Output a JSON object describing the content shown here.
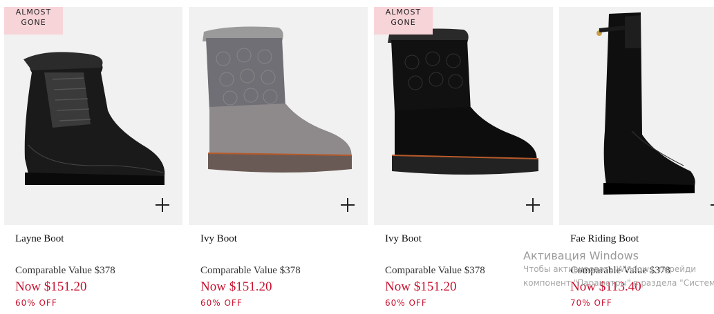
{
  "products": [
    {
      "badge": [
        "ALMOST",
        "GONE"
      ],
      "name": "Layne Boot",
      "comparable": "Comparable Value $378",
      "now": "Now $151.20",
      "discount": "60% OFF",
      "color": "black"
    },
    {
      "badge": null,
      "name": "Ivy Boot",
      "comparable": "Comparable Value $378",
      "now": "Now $151.20",
      "discount": "60% OFF",
      "color": "grey"
    },
    {
      "badge": [
        "ALMOST",
        "GONE"
      ],
      "name": "Ivy Boot",
      "comparable": "Comparable Value $378",
      "now": "Now $151.20",
      "discount": "60% OFF",
      "color": "black"
    },
    {
      "badge": null,
      "name": "Fae Riding Boot",
      "comparable": "Comparable Value $378",
      "now": "Now $113.40",
      "discount": "70% OFF",
      "color": "black"
    }
  ],
  "windows_activation": {
    "title": "Активация Windows",
    "line1": "Чтобы активировать Windows, перейди",
    "line2": "компонент \"Параметры\" в раздела \"Систем"
  },
  "colors": {
    "price_red": "#c8102e",
    "badge_pink": "#f7d4d8",
    "image_bg": "#f1f1f1"
  }
}
